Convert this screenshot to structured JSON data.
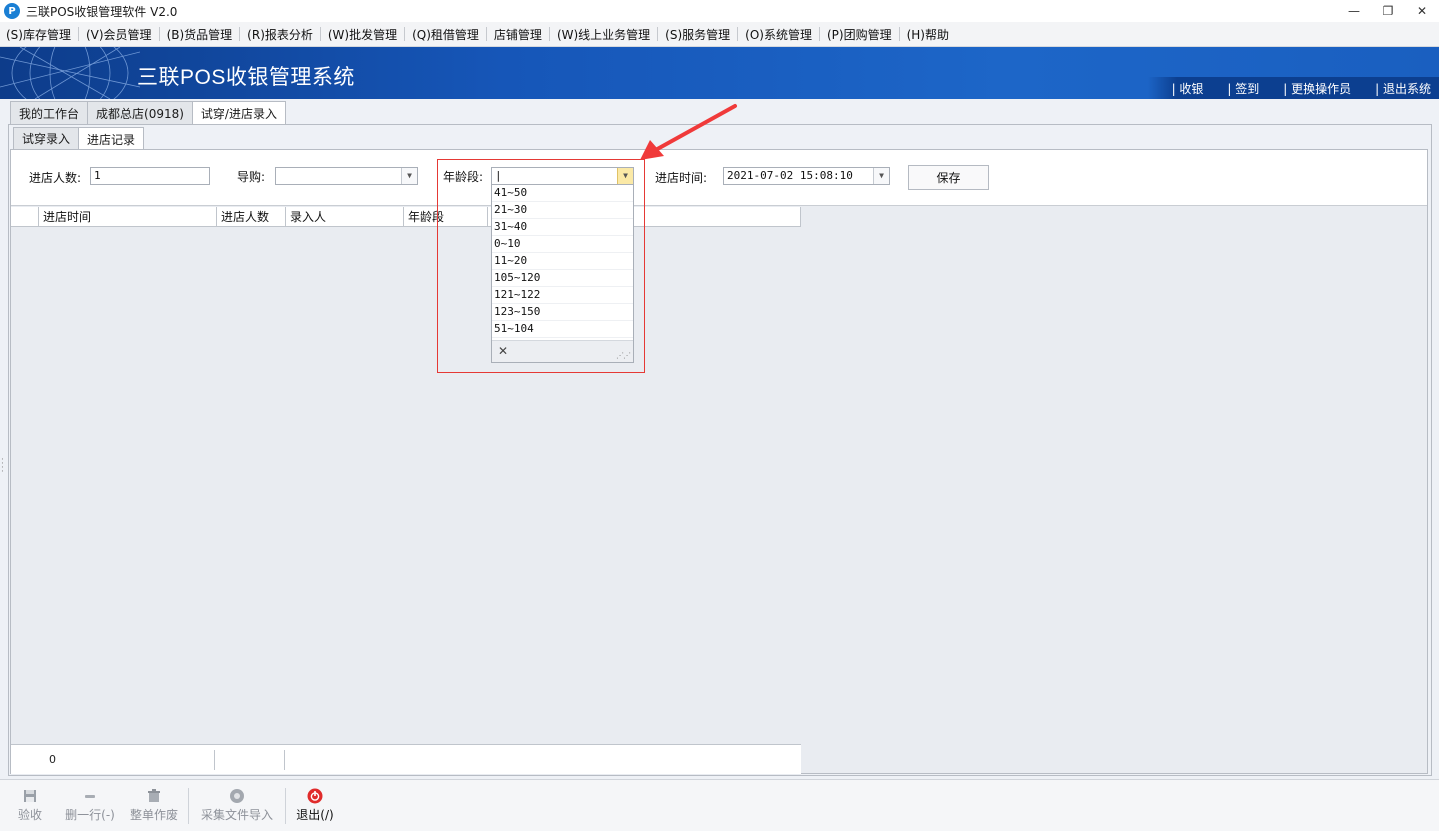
{
  "window": {
    "title": "三联POS收银管理软件 V2.0",
    "icon_letter": "P",
    "minimize": "—",
    "restore": "❐",
    "close": "✕"
  },
  "menu": [
    "(S)库存管理",
    "(V)会员管理",
    "(B)货品管理",
    "(R)报表分析",
    "(W)批发管理",
    "(Q)租借管理",
    "店铺管理",
    "(W)线上业务管理",
    "(S)服务管理",
    "(O)系统管理",
    "(P)团购管理",
    "(H)帮助"
  ],
  "banner": {
    "title": "三联POS收银管理系统",
    "links": [
      "| 收银",
      "| 签到",
      "| 更换操作员",
      "| 退出系统"
    ]
  },
  "top_tabs": [
    "我的工作台",
    "成都总店(0918)",
    "试穿/进店录入"
  ],
  "sub_tabs": [
    "试穿录入",
    "进店记录"
  ],
  "form": {
    "count_label": "进店人数:",
    "count_value": "1",
    "guide_label": "导购:",
    "guide_value": "",
    "age_label": "年龄段:",
    "age_value": "|",
    "time_label": "进店时间:",
    "time_value": "2021-07-02 15:08:10",
    "save_label": "保存"
  },
  "grid": {
    "columns": [
      "进店时间",
      "进店人数",
      "录入人",
      "年龄段"
    ],
    "footer_total": "0"
  },
  "age_options": [
    "41~50",
    "21~30",
    "31~40",
    "0~10",
    "11~20",
    "105~120",
    "121~122",
    "123~150",
    "51~104"
  ],
  "dropdown": {
    "close": "✕",
    "grip": "⋰⋰"
  },
  "toolbar": [
    {
      "label": "验收",
      "icon": "save-icon",
      "enabled": false
    },
    {
      "label": "删一行(-)",
      "icon": "minus-icon",
      "enabled": false
    },
    {
      "label": "整单作废",
      "icon": "trash-icon",
      "enabled": false
    },
    {
      "label": "采集文件导入",
      "icon": "import-icon",
      "enabled": false
    },
    {
      "label": "退出(/)",
      "icon": "power-icon",
      "enabled": true
    }
  ],
  "colors": {
    "banner": "#1656b8",
    "highlight": "#e53935",
    "exit_icon": "#e02b2b"
  }
}
